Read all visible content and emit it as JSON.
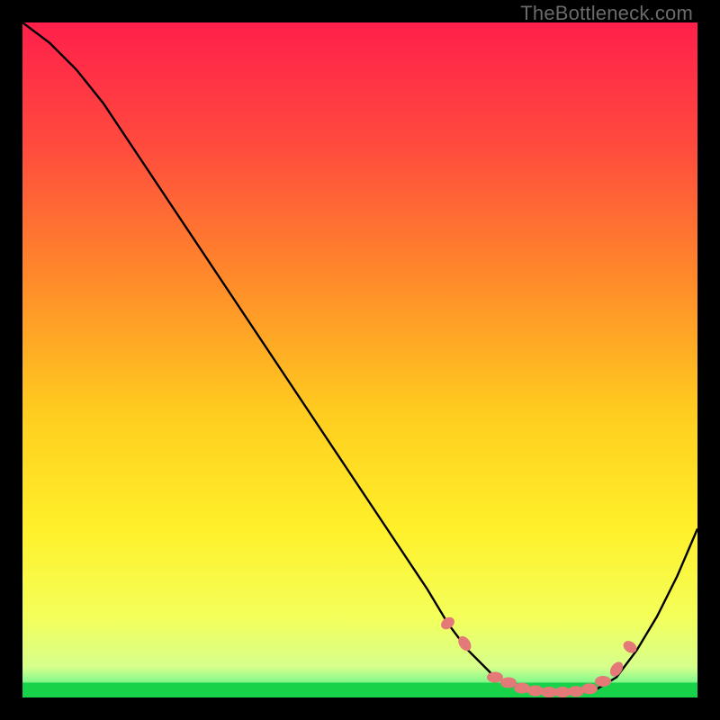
{
  "watermark": "TheBottleneck.com",
  "chart_data": {
    "type": "line",
    "title": "",
    "xlabel": "",
    "ylabel": "",
    "xlim": [
      0,
      100
    ],
    "ylim": [
      0,
      100
    ],
    "grid": false,
    "series": [
      {
        "name": "curve",
        "stroke": "#000000",
        "fill": "none",
        "x": [
          0,
          4,
          8,
          12,
          16,
          20,
          24,
          28,
          32,
          36,
          40,
          44,
          48,
          52,
          56,
          60,
          63,
          66,
          70,
          74,
          78,
          82,
          85,
          88,
          91,
          94,
          97,
          100
        ],
        "y": [
          100,
          97,
          93,
          88,
          82,
          76,
          70,
          64,
          58,
          52,
          46,
          40,
          34,
          28,
          22,
          16,
          11,
          7,
          3,
          1.2,
          0.6,
          0.6,
          1.2,
          3,
          7,
          12,
          18,
          25
        ]
      },
      {
        "name": "green-band",
        "stroke": "#18d24a",
        "fill": "#18d24a",
        "x": [
          0,
          100
        ],
        "y": [
          0,
          0
        ],
        "band_top": 2.2,
        "band_bottom": 0
      },
      {
        "name": "optimum-dots",
        "stroke": "#e47a78",
        "fill": "#e47a78",
        "marker": "ellipse",
        "x": [
          63,
          65.5,
          70,
          72,
          74,
          76,
          78,
          80,
          82,
          84,
          86,
          88,
          90
        ],
        "y": [
          11,
          8,
          3,
          2.2,
          1.4,
          1.0,
          0.8,
          0.8,
          0.9,
          1.3,
          2.4,
          4.2,
          7.5
        ]
      }
    ],
    "gradient_stops": [
      {
        "offset": 0.0,
        "color": "#ff1f4b"
      },
      {
        "offset": 0.18,
        "color": "#ff4a3e"
      },
      {
        "offset": 0.38,
        "color": "#ff8a2a"
      },
      {
        "offset": 0.58,
        "color": "#ffcd1f"
      },
      {
        "offset": 0.75,
        "color": "#fff02a"
      },
      {
        "offset": 0.88,
        "color": "#f4ff5a"
      },
      {
        "offset": 0.955,
        "color": "#d6ff8c"
      },
      {
        "offset": 0.975,
        "color": "#8cf98c"
      },
      {
        "offset": 1.0,
        "color": "#18d24a"
      }
    ]
  }
}
